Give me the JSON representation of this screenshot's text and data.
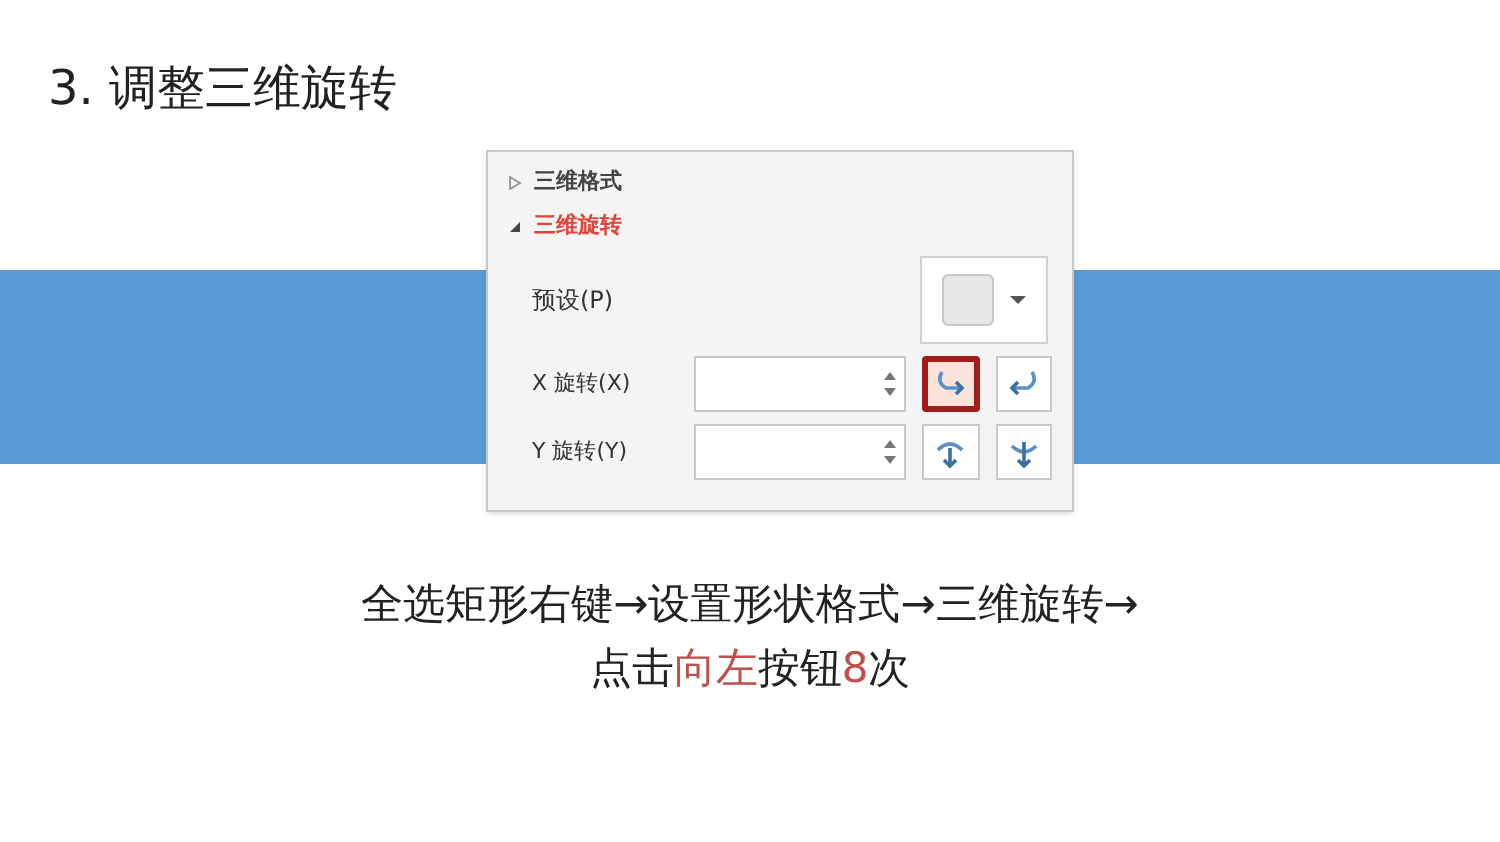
{
  "title": "3. 调整三维旋转",
  "panel": {
    "sections": [
      {
        "label": "三维格式",
        "expanded": false,
        "selected": false
      },
      {
        "label": "三维旋转",
        "expanded": true,
        "selected": true
      }
    ],
    "preset": {
      "label": "预设(P)"
    },
    "rotations": [
      {
        "label": "X 旋转(X)",
        "buttons": [
          {
            "kind": "left",
            "selected": true
          },
          {
            "kind": "right",
            "selected": false
          }
        ]
      },
      {
        "label": "Y 旋转(Y)",
        "buttons": [
          {
            "kind": "up",
            "selected": false
          },
          {
            "kind": "down",
            "selected": false
          }
        ]
      }
    ]
  },
  "caption": {
    "line_1": "全选矩形右键→设置形状格式→三维旋转→",
    "line_2": [
      {
        "text": "点击",
        "highlight": false
      },
      {
        "text": "向左",
        "highlight": true
      },
      {
        "text": "按钮",
        "highlight": false
      },
      {
        "text": "8",
        "highlight": true
      },
      {
        "text": "次",
        "highlight": false
      }
    ]
  }
}
